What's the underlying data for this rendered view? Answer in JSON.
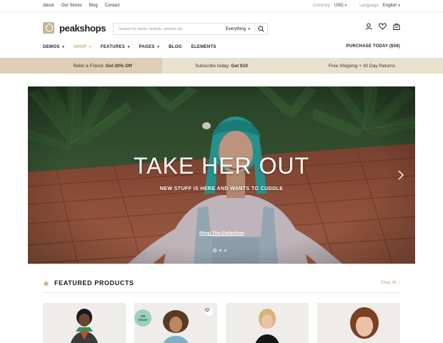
{
  "topbar": {
    "links": [
      "About",
      "Our Stores",
      "Blog",
      "Contact"
    ],
    "currency_label": "Currency",
    "currency_value": "USD",
    "language_label": "Language",
    "language_value": "English"
  },
  "header": {
    "logo_text": "peakshops",
    "search_placeholder": "Search for items, brands, articles etc.",
    "search_category": "Everything",
    "icons": [
      "user-icon",
      "heart-icon",
      "bag-icon"
    ]
  },
  "nav": {
    "items": [
      "DEMOS",
      "SHOP",
      "FEATURES",
      "PAGES",
      "BLOG",
      "ELEMENTS"
    ],
    "active_item": "SHOP",
    "purchase_label": "PURCHASE TODAY ($59)"
  },
  "promo": {
    "p1_text": "Refer a Friend.",
    "p1_bold": "Get 20% Off",
    "p2_text": "Subscribe today:",
    "p2_bold": "Get $10",
    "p3_text": "Free Shipping + 30 Day Returns"
  },
  "hero": {
    "title": "TAKE HER OUT",
    "subtitle": "NEW STUFF IS HERE AND WANTS TO CUDDLE",
    "cta": "Shop The Collection",
    "slide_count": 3,
    "active_slide": 1
  },
  "featured": {
    "title": "FEATURED PRODUCTS",
    "shop_all": "Shop All",
    "badge_line1": "ON",
    "badge_line2": "SALE!"
  },
  "colors": {
    "accent": "#c7a77a",
    "logo": "#c7b58f",
    "promo_bg": "#e9e0cd",
    "promo_active": "#ddcfb3",
    "badge": "#9bd1bf"
  }
}
